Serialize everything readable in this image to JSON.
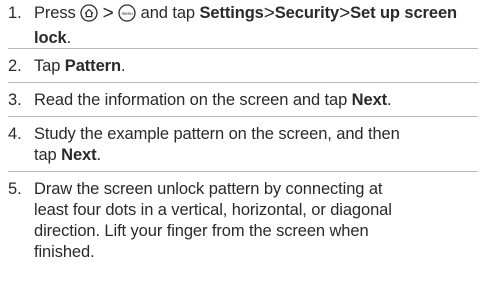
{
  "steps": [
    {
      "number": "1.",
      "intro": "Press",
      "sep": ">",
      "and_tap": "and tap",
      "settings": "Settings",
      "security": "Security",
      "set_up_screen_lock": "Set up screen lock",
      "period": ".",
      "home_icon": "home-icon",
      "menu_icon": "menu-icon",
      "menu_icon_text": "menu"
    },
    {
      "number": "2.",
      "before": "Tap",
      "bold": "Pattern",
      "after": "."
    },
    {
      "number": "3.",
      "before": "Read the information on the screen and tap",
      "bold": "Next",
      "after": "."
    },
    {
      "number": "4.",
      "line1": "Study the example pattern on the screen, and then",
      "before": "tap",
      "bold": "Next",
      "after": "."
    },
    {
      "number": "5.",
      "line1": "Draw the screen unlock pattern by connecting at",
      "line2": "least four dots in a vertical, horizontal, or diagonal",
      "line3": "direction. Lift your finger from the screen when",
      "line4": "finished."
    }
  ],
  "colors": {
    "text": "#2a2a2a",
    "rule": "#b9b9b9"
  }
}
